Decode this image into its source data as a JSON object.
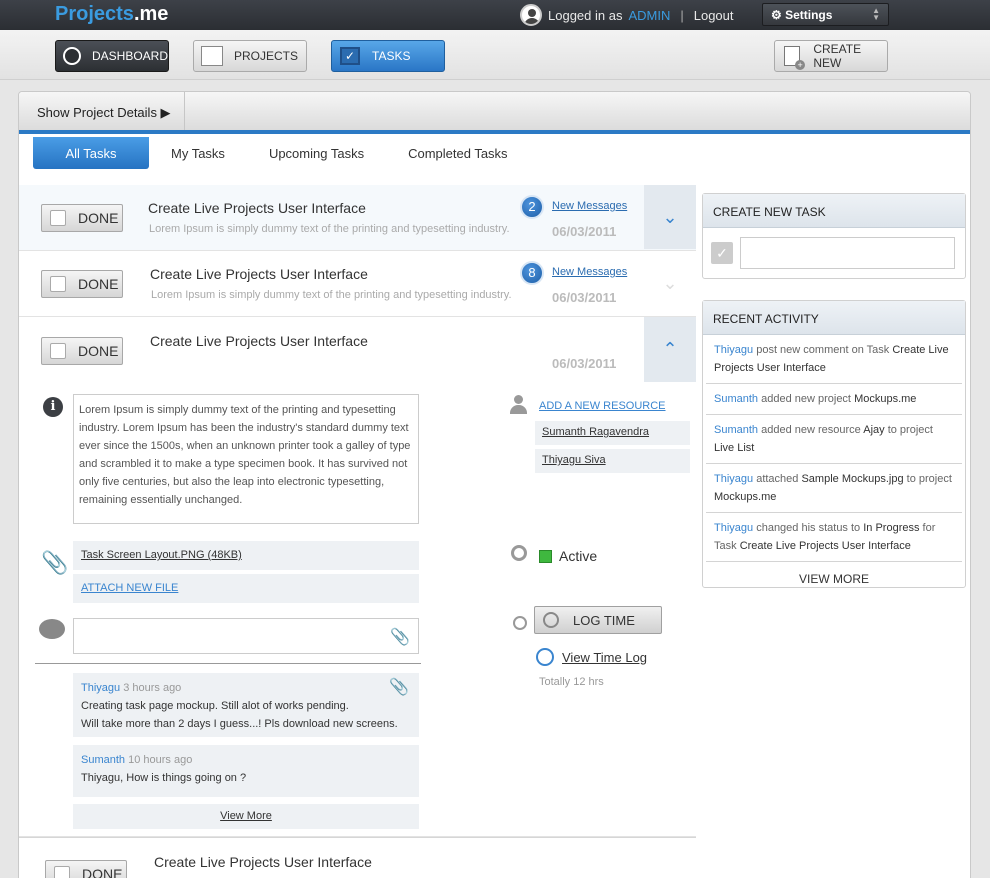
{
  "app": {
    "logo_main": "Projects",
    "logo_suffix": ".me"
  },
  "user": {
    "prefix": "Logged in as",
    "name": "ADMIN",
    "separator": "|",
    "logout": "Logout"
  },
  "settings": {
    "label": "⚙ Settings"
  },
  "nav": {
    "dashboard": "DASHBOARD",
    "projects": "PROJECTS",
    "tasks": "TASKS",
    "create": "CREATE NEW"
  },
  "panel": {
    "show_details": "Show Project Details ▶"
  },
  "tabs": [
    "All Tasks",
    "My Tasks",
    "Upcoming Tasks",
    "Completed Tasks"
  ],
  "done_label": "DONE",
  "tasks": [
    {
      "title": "Create Live Projects User Interface",
      "desc": "Lorem Ipsum is simply dummy text of the printing and typesetting industry.",
      "badge": "2",
      "new_msgs": "New Messages",
      "date": "06/03/2011"
    },
    {
      "title": "Create Live Projects User Interface",
      "desc": "Lorem Ipsum is simply dummy text of the printing and typesetting industry.",
      "badge": "8",
      "new_msgs": "New Messages",
      "date": "06/03/2011"
    },
    {
      "title": "Create Live Projects User Interface",
      "date": "06/03/2011"
    },
    {
      "title": "Create Live Projects User Interface"
    }
  ],
  "expanded": {
    "description": "Lorem Ipsum is simply dummy text of the printing and typesetting industry. Lorem Ipsum has been the industry's standard dummy text ever since the 1500s, when an unknown printer took a galley of type and scrambled it to make a type specimen book. It has survived not only five centuries, but also the leap into electronic typesetting, remaining essentially unchanged.",
    "file": "Task Screen Layout.PNG (48KB)",
    "attach": "ATTACH NEW FILE",
    "add_resource": "ADD A NEW RESOURCE",
    "resources": [
      "Sumanth Ragavendra",
      "Thiyagu Siva"
    ],
    "status": "Active",
    "log_time": "LOG TIME",
    "view_log": "View Time Log",
    "total": "Totally 12 hrs",
    "comments": [
      {
        "who": "Thiyagu",
        "ago": "3 hours ago",
        "line1": "Creating task page mockup. Still alot of works pending.",
        "line2": "Will take more than 2 days I guess...! Pls download new screens."
      },
      {
        "who": "Sumanth",
        "ago": "10 hours ago",
        "line1": "Thiyagu, How is things going on ?"
      }
    ],
    "view_more": "View More"
  },
  "sidebar": {
    "create_title": "CREATE NEW TASK",
    "activity_title": "RECENT ACTIVITY",
    "activity": [
      {
        "who": "Thiyagu",
        "verb": "post new comment on Task",
        "target": "Create Live Projects User Interface"
      },
      {
        "who": "Sumanth",
        "verb": "added new project",
        "target": "Mockups.me"
      },
      {
        "who": "Sumanth",
        "verb": "added new resource",
        "target": "Ajay",
        "verb2": "to project",
        "target2": "Live List"
      },
      {
        "who": "Thiyagu",
        "verb": "attached",
        "target": "Sample Mockups.jpg",
        "verb2": "to project",
        "target2": "Mockups.me"
      },
      {
        "who": "Thiyagu",
        "verb": "changed his status to",
        "target": "In Progress",
        "verb2": "for Task",
        "target2": "Create Live Projects User Interface"
      }
    ],
    "view_more": "VIEW MORE"
  }
}
